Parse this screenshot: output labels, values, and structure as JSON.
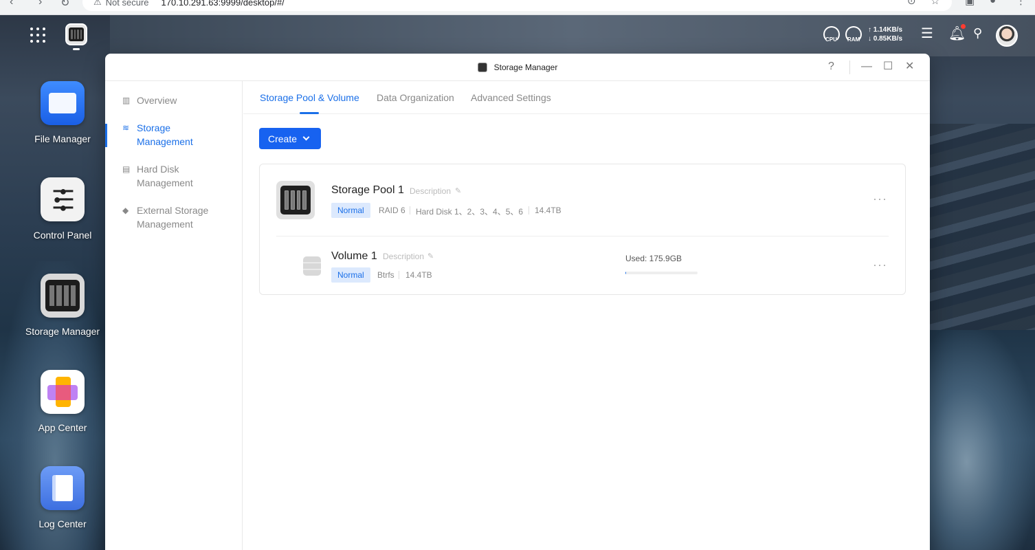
{
  "browser": {
    "security_label": "Not secure",
    "url": "170.10.291.63:9999/desktop/#/"
  },
  "topbar": {
    "cpu_label": "CPU",
    "ram_label": "RAM",
    "upload_speed": "↑ 1.14KB/s",
    "download_speed": "↓ 0.85KB/s"
  },
  "desktop": {
    "icons": [
      {
        "label": "File Manager",
        "icon": "folder-icon"
      },
      {
        "label": "Control Panel",
        "icon": "sliders-icon"
      },
      {
        "label": "Storage Manager",
        "icon": "storage-icon"
      },
      {
        "label": "App Center",
        "icon": "app-center-icon"
      },
      {
        "label": "Log Center",
        "icon": "log-icon"
      }
    ]
  },
  "window": {
    "title": "Storage Manager",
    "help": "?",
    "sidebar": [
      {
        "label": "Overview",
        "icon": "chart-icon"
      },
      {
        "label": "Storage Management",
        "icon": "database-icon",
        "active": true
      },
      {
        "label": "Hard Disk Management",
        "icon": "hard-disk-icon"
      },
      {
        "label": "External Storage Management",
        "icon": "usb-icon"
      }
    ],
    "tabs": [
      "Storage Pool & Volume",
      "Data Organization",
      "Advanced Settings"
    ],
    "active_tab": 0,
    "create_label": "Create",
    "pool": {
      "name": "Storage Pool 1",
      "description": "Description",
      "status": "Normal",
      "raid": "RAID 6",
      "disks": "Hard Disk 1、2、3、4、5、6",
      "capacity": "14.4TB",
      "more": "···"
    },
    "volume": {
      "name": "Volume 1",
      "description": "Description",
      "status": "Normal",
      "fs": "Btrfs",
      "capacity": "14.4TB",
      "used_label": "Used: 175.9GB",
      "used_fraction": 0.012,
      "more": "···"
    }
  },
  "colors": {
    "accent": "#1a6fe8",
    "button": "#1762f0",
    "badge_bg": "#dce9fd"
  }
}
